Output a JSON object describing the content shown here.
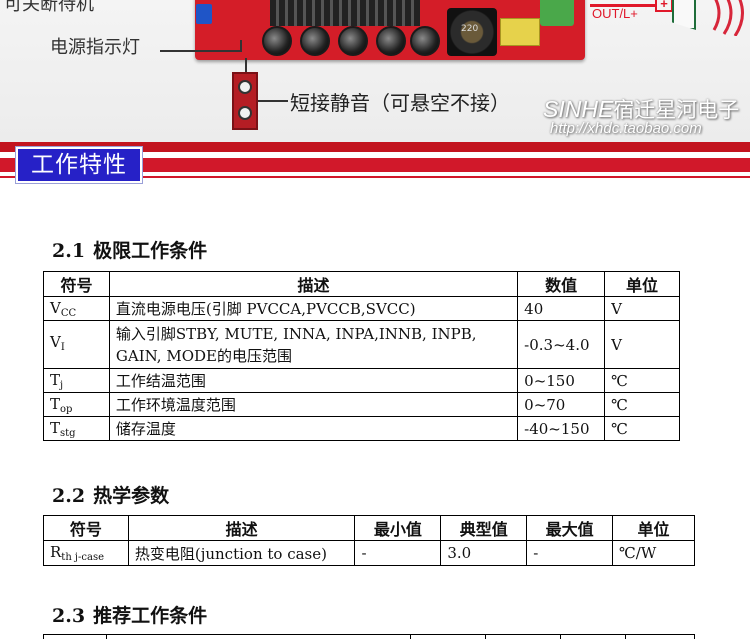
{
  "photo": {
    "top_label": "可关断待机",
    "led_label": "电源指示灯",
    "mute_label": "短接静音（可悬空不接）",
    "out_label": "OUT/L+",
    "plus_sign": "+",
    "inductor_marking": "220",
    "brand": "SINHE",
    "brand_name": "宿迁星河电子",
    "brand_url": "http://xhdc.taobao.com"
  },
  "banner": {
    "title": "工作特性"
  },
  "section1": {
    "num": "2.1",
    "title": "极限工作条件",
    "headers": [
      "符号",
      "描述",
      "数值",
      "单位"
    ],
    "rows": [
      {
        "sym": "V",
        "sub": "CC",
        "desc": "直流电源电压(引脚 PVCCA,PVCCB,SVCC)",
        "value": "40",
        "unit": "V"
      },
      {
        "sym": "V",
        "sub": "I",
        "desc": "输入引脚STBY, MUTE, INNA, INPA,INNB, INPB, GAIN, MODE的电压范围",
        "value": "-0.3~4.0",
        "unit": "V"
      },
      {
        "sym": "T",
        "sub": "j",
        "desc": "工作结温范围",
        "value": "0~150",
        "unit": "℃"
      },
      {
        "sym": "T",
        "sub": "op",
        "desc": "工作环境温度范围",
        "value": "0~70",
        "unit": "℃"
      },
      {
        "sym": "T",
        "sub": "stg",
        "desc": "储存温度",
        "value": "-40~150",
        "unit": "℃"
      }
    ]
  },
  "section2": {
    "num": "2.2",
    "title": "热学参数",
    "headers": [
      "符号",
      "描述",
      "最小值",
      "典型值",
      "最大值",
      "单位"
    ],
    "rows": [
      {
        "sym": "R",
        "sub": "th j-case",
        "desc": "热变电阻(junction to case)",
        "min": "-",
        "typ": "3.0",
        "max": "-",
        "unit": "℃/W"
      }
    ]
  },
  "section3": {
    "num": "2.3",
    "title": "推荐工作条件"
  }
}
